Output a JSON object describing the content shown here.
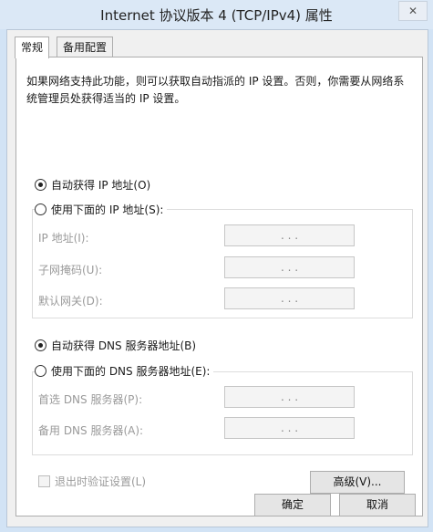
{
  "window": {
    "title": "Internet 协议版本 4 (TCP/IPv4) 属性",
    "close_glyph": "✕"
  },
  "tabs": [
    {
      "label": "常规"
    },
    {
      "label": "备用配置"
    }
  ],
  "description": "如果网络支持此功能，则可以获取自动指派的 IP 设置。否则，你需要从网络系统管理员处获得适当的 IP 设置。",
  "ip_section": {
    "auto_label": "自动获得 IP 地址(O)",
    "manual_label": "使用下面的 IP 地址(S):",
    "selected": "auto",
    "fields": [
      {
        "label": "IP 地址(I):",
        "value": ". . ."
      },
      {
        "label": "子网掩码(U):",
        "value": ". . ."
      },
      {
        "label": "默认网关(D):",
        "value": ". . ."
      }
    ]
  },
  "dns_section": {
    "auto_label": "自动获得 DNS 服务器地址(B)",
    "manual_label": "使用下面的 DNS 服务器地址(E):",
    "selected": "auto",
    "fields": [
      {
        "label": "首选 DNS 服务器(P):",
        "value": ". . ."
      },
      {
        "label": "备用 DNS 服务器(A):",
        "value": ". . ."
      }
    ]
  },
  "validate_on_exit": {
    "label": "退出时验证设置(L)",
    "checked": false,
    "enabled": false
  },
  "buttons": {
    "advanced": "高级(V)...",
    "ok": "确定",
    "cancel": "取消"
  }
}
